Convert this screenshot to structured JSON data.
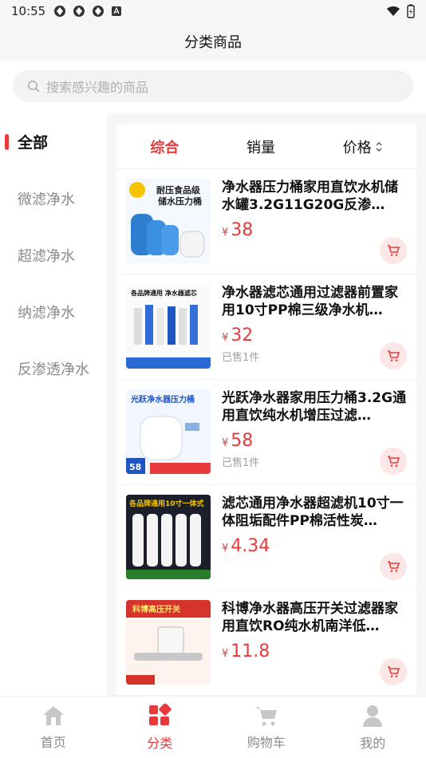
{
  "status": {
    "time": "10:55"
  },
  "header": {
    "title": "分类商品"
  },
  "search": {
    "placeholder": "搜索感兴趣的商品"
  },
  "sidebar": {
    "items": [
      {
        "label": "全部"
      },
      {
        "label": "微滤净水"
      },
      {
        "label": "超滤净水"
      },
      {
        "label": "纳滤净水"
      },
      {
        "label": "反渗透净水"
      }
    ]
  },
  "sort": {
    "comprehensive": "综合",
    "sales": "销量",
    "price": "价格"
  },
  "products": [
    {
      "title": "净水器压力桶家用直饮水机储水罐3.2G11G20G反渗…",
      "yen": "¥",
      "price": "38",
      "sold": "",
      "thumb_text_1": "耐压食品级",
      "thumb_text_2": "储水压力桶"
    },
    {
      "title": "净水器滤芯通用过滤器前置家用10寸PP棉三级净水机…",
      "yen": "¥",
      "price": "32",
      "sold": "已售1件",
      "thumb_text_1": "各品牌通用 净水器滤芯",
      "thumb_text_2": ""
    },
    {
      "title": "光跃净水器家用压力桶3.2G通用直饮纯水机增压过滤…",
      "yen": "¥",
      "price": "58",
      "sold": "已售1件",
      "thumb_text_1": "光跃净水器压力桶",
      "thumb_text_2": "58"
    },
    {
      "title": "滤芯通用净水器超滤机10寸一体阻垢配件PP棉活性炭…",
      "yen": "¥",
      "price": "4.34",
      "sold": "",
      "thumb_text_1": "各品牌通用10寸一体式",
      "thumb_text_2": ""
    },
    {
      "title": "科博净水器高压开关过滤器家用直饮RO纯水机南洋低…",
      "yen": "¥",
      "price": "11.8",
      "sold": "",
      "thumb_text_1": "科博高压开关",
      "thumb_text_2": ""
    }
  ],
  "tabbar": [
    {
      "label": "首页"
    },
    {
      "label": "分类"
    },
    {
      "label": "购物车"
    },
    {
      "label": "我的"
    }
  ],
  "colors": {
    "accent": "#e83a3a",
    "muted": "#8a8a8a"
  }
}
